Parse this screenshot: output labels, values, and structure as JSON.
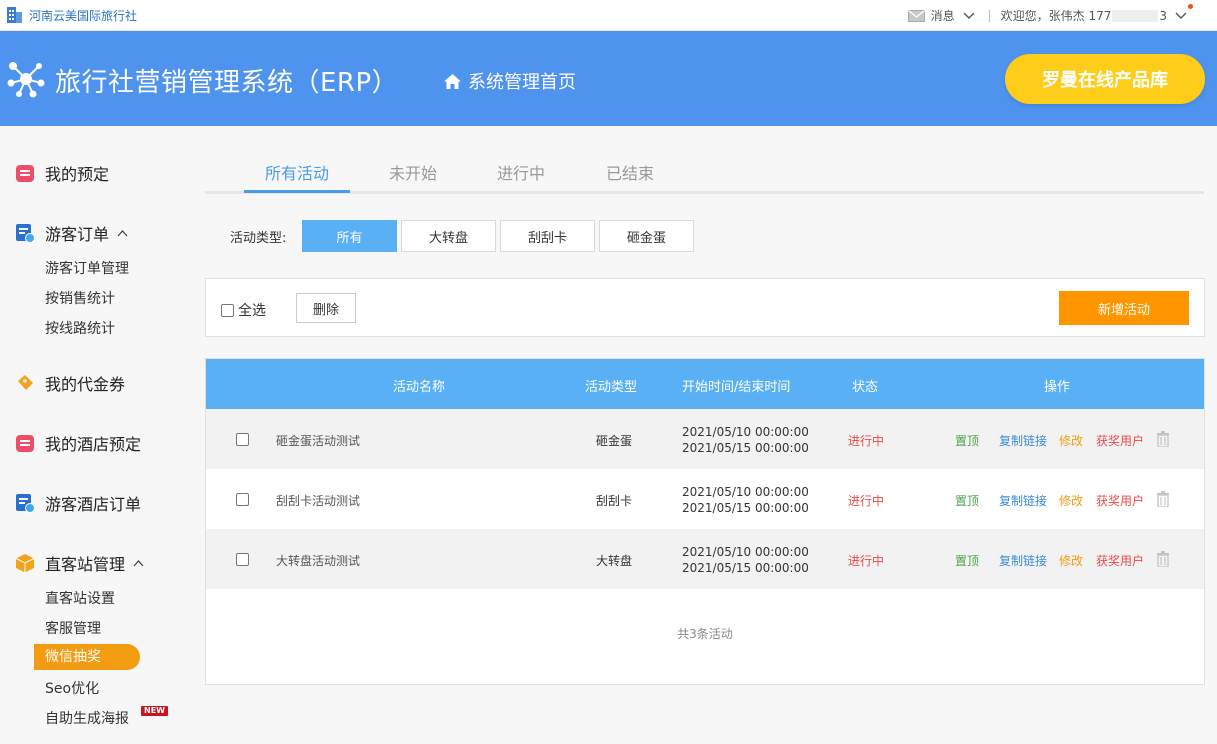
{
  "topbar": {
    "company": "河南云美国际旅行社",
    "messages": "消息",
    "welcome": "欢迎您，张伟杰 177",
    "phone_tail": "3"
  },
  "header": {
    "system_name": "旅行社营销管理系统（ERP）",
    "home_link": "系统管理首页",
    "library_button": "罗曼在线产品库"
  },
  "sidebar": {
    "groups": [
      {
        "label": "我的预定",
        "icon": "calendar-icon"
      },
      {
        "label": "游客订单",
        "icon": "order-icon",
        "sub": [
          "游客订单管理",
          "按销售统计",
          "按线路统计"
        ]
      },
      {
        "label": "我的代金券",
        "icon": "coupon-icon"
      },
      {
        "label": "我的酒店预定",
        "icon": "calendar-icon"
      },
      {
        "label": "游客酒店订单",
        "icon": "order-icon"
      },
      {
        "label": "直客站管理",
        "icon": "box-icon",
        "sub": [
          "直客站设置",
          "客服管理",
          "微信抽奖",
          "Seo优化",
          "自助生成海报"
        ]
      }
    ],
    "new_badge": "NEW"
  },
  "tabs": [
    "所有活动",
    "未开始",
    "进行中",
    "已结束"
  ],
  "filter": {
    "label": "活动类型:",
    "options": [
      "所有",
      "大转盘",
      "刮刮卡",
      "砸金蛋"
    ],
    "selected": "所有"
  },
  "toolbar": {
    "select_all": "全选",
    "delete": "删除",
    "add": "新增活动"
  },
  "table": {
    "headers": [
      "活动名称",
      "活动类型",
      "开始时间/结束时间",
      "状态",
      "操作"
    ],
    "rows": [
      {
        "name": "砸金蛋活动测试",
        "type": "砸金蛋",
        "start": "2021/05/10 00:00:00",
        "end": "2021/05/15 00:00:00",
        "status": "进行中"
      },
      {
        "name": "刮刮卡活动测试",
        "type": "刮刮卡",
        "start": "2021/05/10 00:00:00",
        "end": "2021/05/15 00:00:00",
        "status": "进行中"
      },
      {
        "name": "大转盘活动测试",
        "type": "大转盘",
        "start": "2021/05/10 00:00:00",
        "end": "2021/05/15 00:00:00",
        "status": "进行中"
      }
    ],
    "actions": {
      "top": "置顶",
      "copy": "复制链接",
      "edit": "修改",
      "winners": "获奖用户"
    },
    "footer": "共3条活动"
  },
  "colors": {
    "header_bg": "#4e93ee",
    "accent_blue": "#5ab0f5",
    "orange": "#ff9600",
    "yellow": "#fecd1a",
    "status_red": "#e94b4b"
  }
}
